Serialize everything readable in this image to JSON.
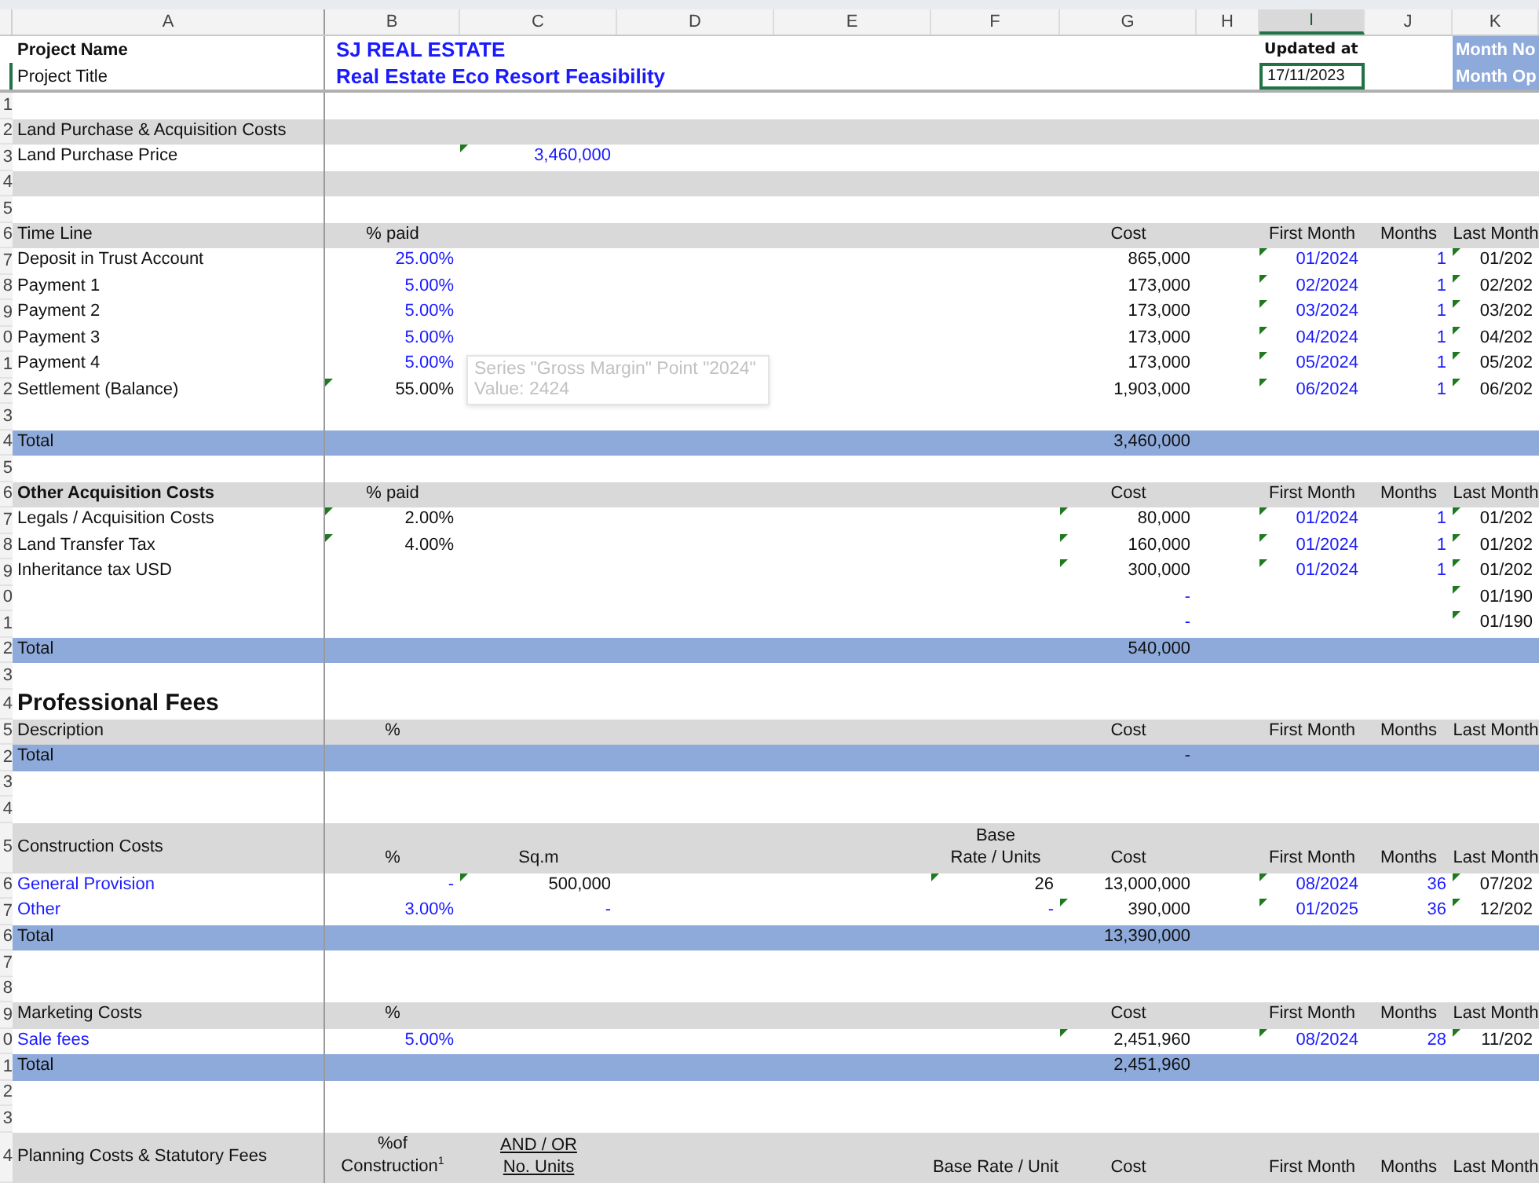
{
  "column_headers": [
    {
      "label": "A",
      "selected": false
    },
    {
      "label": "B",
      "selected": false
    },
    {
      "label": "C",
      "selected": false
    },
    {
      "label": "D",
      "selected": false
    },
    {
      "label": "E",
      "selected": false
    },
    {
      "label": "F",
      "selected": false
    },
    {
      "label": "G",
      "selected": false
    },
    {
      "label": "H",
      "selected": false
    },
    {
      "label": "I",
      "selected": true
    },
    {
      "label": "J",
      "selected": false
    },
    {
      "label": "K",
      "selected": false
    }
  ],
  "project": {
    "name_label": "Project Name",
    "name": "SJ REAL ESTATE",
    "title_label": "Project Title",
    "title": "Real Estate Eco Resort Feasibility",
    "updated_label": "Updated at",
    "updated_value": "17/11/2023",
    "updated_selected": true,
    "side_labels": [
      "Month No",
      "Month Op"
    ]
  },
  "rows": [
    {
      "num": "1",
      "kind": "blank"
    },
    {
      "num": "2",
      "kind": "header",
      "cells": {
        "a": {
          "text": "Land Purchase & Acquisition Costs",
          "input": false,
          "flag": false
        }
      }
    },
    {
      "num": "3",
      "kind": "item",
      "cells": {
        "a": {
          "text": "Land Purchase Price",
          "input": false,
          "flag": false
        },
        "c": {
          "text": "3,460,000",
          "input": true,
          "flag": true
        }
      }
    },
    {
      "num": "4",
      "kind": "header"
    },
    {
      "num": "5",
      "kind": "blank"
    },
    {
      "num": "6",
      "kind": "header",
      "cells": {
        "a": {
          "text": "Time Line",
          "input": false,
          "flag": false
        },
        "b": {
          "text": "% paid",
          "input": false,
          "flag": false
        },
        "g": {
          "text": "Cost",
          "input": false,
          "flag": false
        },
        "i": {
          "text": "First Month",
          "input": false,
          "flag": false
        },
        "j": {
          "text": "Months",
          "input": false,
          "flag": false
        },
        "k": {
          "text": "Last Month",
          "input": false,
          "flag": false
        }
      }
    },
    {
      "num": "7",
      "kind": "item",
      "cells": {
        "a": {
          "text": "Deposit in Trust Account",
          "input": false,
          "flag": false
        },
        "b": {
          "text": "25.00%",
          "input": true,
          "flag": false
        },
        "g": {
          "text": "865,000",
          "input": false,
          "flag": false
        },
        "i": {
          "text": "01/2024",
          "input": true,
          "flag": true
        },
        "j": {
          "text": "1",
          "input": true,
          "flag": false
        },
        "k": {
          "text": "01/202",
          "input": false,
          "flag": true
        }
      }
    },
    {
      "num": "8",
      "kind": "item",
      "cells": {
        "a": {
          "text": "Payment 1",
          "input": false,
          "flag": false
        },
        "b": {
          "text": "5.00%",
          "input": true,
          "flag": false
        },
        "g": {
          "text": "173,000",
          "input": false,
          "flag": false
        },
        "i": {
          "text": "02/2024",
          "input": true,
          "flag": true
        },
        "j": {
          "text": "1",
          "input": true,
          "flag": false
        },
        "k": {
          "text": "02/202",
          "input": false,
          "flag": true
        }
      }
    },
    {
      "num": "9",
      "kind": "item",
      "cells": {
        "a": {
          "text": "Payment 2",
          "input": false,
          "flag": false
        },
        "b": {
          "text": "5.00%",
          "input": true,
          "flag": false
        },
        "g": {
          "text": "173,000",
          "input": false,
          "flag": false
        },
        "i": {
          "text": "03/2024",
          "input": true,
          "flag": true
        },
        "j": {
          "text": "1",
          "input": true,
          "flag": false
        },
        "k": {
          "text": "03/202",
          "input": false,
          "flag": true
        }
      }
    },
    {
      "num": "0",
      "kind": "item",
      "cells": {
        "a": {
          "text": "Payment 3",
          "input": false,
          "flag": false
        },
        "b": {
          "text": "5.00%",
          "input": true,
          "flag": false
        },
        "g": {
          "text": "173,000",
          "input": false,
          "flag": false
        },
        "i": {
          "text": "04/2024",
          "input": true,
          "flag": true
        },
        "j": {
          "text": "1",
          "input": true,
          "flag": false
        },
        "k": {
          "text": "04/202",
          "input": false,
          "flag": true
        }
      }
    },
    {
      "num": "1",
      "kind": "item",
      "cells": {
        "a": {
          "text": "Payment 4",
          "input": false,
          "flag": false
        },
        "b": {
          "text": "5.00%",
          "input": true,
          "flag": false
        },
        "g": {
          "text": "173,000",
          "input": false,
          "flag": false
        },
        "i": {
          "text": "05/2024",
          "input": true,
          "flag": true
        },
        "j": {
          "text": "1",
          "input": true,
          "flag": false
        },
        "k": {
          "text": "05/202",
          "input": false,
          "flag": true
        }
      }
    },
    {
      "num": "2",
      "kind": "item",
      "cells": {
        "a": {
          "text": "Settlement (Balance)",
          "input": false,
          "flag": false
        },
        "b": {
          "text": "55.00%",
          "input": false,
          "flag": true
        },
        "g": {
          "text": "1,903,000",
          "input": false,
          "flag": false
        },
        "i": {
          "text": "06/2024",
          "input": true,
          "flag": true
        },
        "j": {
          "text": "1",
          "input": true,
          "flag": false
        },
        "k": {
          "text": "06/202",
          "input": false,
          "flag": true
        }
      }
    },
    {
      "num": "3",
      "kind": "blank"
    },
    {
      "num": "4",
      "kind": "total",
      "cells": {
        "a": {
          "text": "Total",
          "input": false,
          "flag": false
        },
        "g": {
          "text": "3,460,000",
          "input": false,
          "flag": false
        }
      }
    },
    {
      "num": "5",
      "kind": "blank"
    },
    {
      "num": "6",
      "kind": "header",
      "cells": {
        "a": {
          "text": "Other Acquisition Costs",
          "input": false,
          "flag": false,
          "bold": true
        },
        "b": {
          "text": "% paid",
          "input": false,
          "flag": false
        },
        "g": {
          "text": "Cost",
          "input": false,
          "flag": false
        },
        "i": {
          "text": "First Month",
          "input": false,
          "flag": false
        },
        "j": {
          "text": "Months",
          "input": false,
          "flag": false
        },
        "k": {
          "text": "Last Month",
          "input": false,
          "flag": false
        }
      }
    },
    {
      "num": "7",
      "kind": "item",
      "cells": {
        "a": {
          "text": "Legals / Acquisition Costs",
          "input": false,
          "flag": false
        },
        "b": {
          "text": "2.00%",
          "input": false,
          "flag": true
        },
        "g": {
          "text": "80,000",
          "input": false,
          "flag": true
        },
        "i": {
          "text": "01/2024",
          "input": true,
          "flag": true
        },
        "j": {
          "text": "1",
          "input": true,
          "flag": false
        },
        "k": {
          "text": "01/202",
          "input": false,
          "flag": true
        }
      }
    },
    {
      "num": "8",
      "kind": "item",
      "cells": {
        "a": {
          "text": "Land Transfer Tax",
          "input": false,
          "flag": false
        },
        "b": {
          "text": "4.00%",
          "input": false,
          "flag": true
        },
        "g": {
          "text": "160,000",
          "input": false,
          "flag": true
        },
        "i": {
          "text": "01/2024",
          "input": true,
          "flag": true
        },
        "j": {
          "text": "1",
          "input": true,
          "flag": false
        },
        "k": {
          "text": "01/202",
          "input": false,
          "flag": true
        }
      }
    },
    {
      "num": "9",
      "kind": "item",
      "cells": {
        "a": {
          "text": "Inheritance tax USD",
          "input": false,
          "flag": false
        },
        "g": {
          "text": "300,000",
          "input": false,
          "flag": true
        },
        "i": {
          "text": "01/2024",
          "input": true,
          "flag": true
        },
        "j": {
          "text": "1",
          "input": true,
          "flag": false
        },
        "k": {
          "text": "01/202",
          "input": false,
          "flag": true
        }
      }
    },
    {
      "num": "0",
      "kind": "item",
      "cells": {
        "g": {
          "text": "-",
          "input": true,
          "flag": false
        },
        "k": {
          "text": "01/190",
          "input": false,
          "flag": true
        }
      }
    },
    {
      "num": "1",
      "kind": "item",
      "cells": {
        "g": {
          "text": "-",
          "input": true,
          "flag": false
        },
        "k": {
          "text": "01/190",
          "input": false,
          "flag": true
        }
      }
    },
    {
      "num": "2",
      "kind": "total",
      "cells": {
        "a": {
          "text": "Total",
          "input": false,
          "flag": false
        },
        "g": {
          "text": "540,000",
          "input": false,
          "flag": false
        }
      }
    },
    {
      "num": "3",
      "kind": "blank"
    },
    {
      "num": "4",
      "kind": "heading",
      "cells": {
        "a": {
          "text": "Professional Fees",
          "input": false,
          "flag": false
        }
      }
    },
    {
      "num": "5",
      "kind": "header",
      "cells": {
        "a": {
          "text": "Description",
          "input": false,
          "flag": false
        },
        "b": {
          "text": "%",
          "input": false,
          "flag": false
        },
        "g": {
          "text": "Cost",
          "input": false,
          "flag": false
        },
        "i": {
          "text": "First Month",
          "input": false,
          "flag": false
        },
        "j": {
          "text": "Months",
          "input": false,
          "flag": false
        },
        "k": {
          "text": "Last Month",
          "input": false,
          "flag": false
        }
      }
    },
    {
      "num": "2",
      "kind": "total",
      "cells": {
        "a": {
          "text": "Total",
          "input": false,
          "flag": false
        },
        "g": {
          "text": "-",
          "input": false,
          "flag": false
        }
      }
    },
    {
      "num": "3",
      "kind": "blank"
    },
    {
      "num": "4",
      "kind": "blank"
    },
    {
      "num": "5",
      "kind": "header",
      "cells": {
        "a": {
          "text": "Construction Costs",
          "input": false,
          "flag": false
        },
        "b": {
          "text": "%",
          "input": false,
          "flag": false
        },
        "c": {
          "text": "Sq.m",
          "input": false,
          "flag": false
        },
        "f": {
          "text": "Base\nRate / Units",
          "input": false,
          "flag": false
        },
        "g": {
          "text": "Cost",
          "input": false,
          "flag": false
        },
        "i": {
          "text": "First Month",
          "input": false,
          "flag": false
        },
        "j": {
          "text": "Months",
          "input": false,
          "flag": false
        },
        "k": {
          "text": "Last Month",
          "input": false,
          "flag": false
        }
      }
    },
    {
      "num": "6",
      "kind": "item",
      "cells": {
        "a": {
          "text": "General Provision",
          "input": true,
          "flag": false
        },
        "b": {
          "text": "-",
          "input": true,
          "flag": false
        },
        "c": {
          "text": "500,000",
          "input": false,
          "flag": true
        },
        "f": {
          "text": "26",
          "input": false,
          "flag": true
        },
        "g": {
          "text": "13,000,000",
          "input": false,
          "flag": false
        },
        "i": {
          "text": "08/2024",
          "input": true,
          "flag": true
        },
        "j": {
          "text": "36",
          "input": true,
          "flag": false
        },
        "k": {
          "text": "07/202",
          "input": false,
          "flag": true
        }
      }
    },
    {
      "num": "7",
      "kind": "item",
      "cells": {
        "a": {
          "text": "Other",
          "input": true,
          "flag": false
        },
        "b": {
          "text": "3.00%",
          "input": true,
          "flag": false
        },
        "c": {
          "text": "-",
          "input": true,
          "flag": false
        },
        "f": {
          "text": "-",
          "input": true,
          "flag": false
        },
        "g": {
          "text": "390,000",
          "input": false,
          "flag": true
        },
        "i": {
          "text": "01/2025",
          "input": true,
          "flag": true
        },
        "j": {
          "text": "36",
          "input": true,
          "flag": false
        },
        "k": {
          "text": "12/202",
          "input": false,
          "flag": true
        }
      }
    },
    {
      "num": "6",
      "kind": "total",
      "cells": {
        "a": {
          "text": "Total",
          "input": false,
          "flag": false
        },
        "g": {
          "text": "13,390,000",
          "input": false,
          "flag": false
        }
      }
    },
    {
      "num": "7",
      "kind": "blank"
    },
    {
      "num": "8",
      "kind": "blank"
    },
    {
      "num": "9",
      "kind": "header",
      "cells": {
        "a": {
          "text": "Marketing Costs",
          "input": false,
          "flag": false
        },
        "b": {
          "text": "%",
          "input": false,
          "flag": false
        },
        "g": {
          "text": "Cost",
          "input": false,
          "flag": false
        },
        "i": {
          "text": "First Month",
          "input": false,
          "flag": false
        },
        "j": {
          "text": "Months",
          "input": false,
          "flag": false
        },
        "k": {
          "text": "Last Month",
          "input": false,
          "flag": false
        }
      }
    },
    {
      "num": "0",
      "kind": "item",
      "cells": {
        "a": {
          "text": "Sale fees",
          "input": true,
          "flag": false
        },
        "b": {
          "text": "5.00%",
          "input": true,
          "flag": false
        },
        "g": {
          "text": "2,451,960",
          "input": false,
          "flag": true
        },
        "i": {
          "text": "08/2024",
          "input": true,
          "flag": true
        },
        "j": {
          "text": "28",
          "input": true,
          "flag": false
        },
        "k": {
          "text": "11/202",
          "input": false,
          "flag": true
        }
      }
    },
    {
      "num": "1",
      "kind": "total",
      "cells": {
        "a": {
          "text": "Total",
          "input": false,
          "flag": false
        },
        "g": {
          "text": "2,451,960",
          "input": false,
          "flag": false
        }
      }
    },
    {
      "num": "2",
      "kind": "blank"
    },
    {
      "num": "3",
      "kind": "blank"
    },
    {
      "num": "4",
      "kind": "header",
      "cells": {
        "a": {
          "text": "Planning Costs & Statutory Fees",
          "input": false,
          "flag": false
        },
        "b": {
          "text": "%of\nConstruction$^{1}$",
          "input": false,
          "flag": false
        },
        "c": {
          "text": "AND / OR\nNo. Units",
          "input": false,
          "flag": false,
          "underlined": true
        },
        "f": {
          "text": "Base Rate / Unit",
          "input": false,
          "flag": false
        },
        "g": {
          "text": "Cost",
          "input": false,
          "flag": false
        },
        "i": {
          "text": "First Month",
          "input": false,
          "flag": false
        },
        "j": {
          "text": "Months",
          "input": false,
          "flag": false
        },
        "k": {
          "text": "Last Month",
          "input": false,
          "flag": false
        }
      }
    }
  ],
  "tooltip": {
    "lines": [
      "Series \"Gross Margin\" Point \"2024\"",
      "Value: 2424"
    ]
  }
}
